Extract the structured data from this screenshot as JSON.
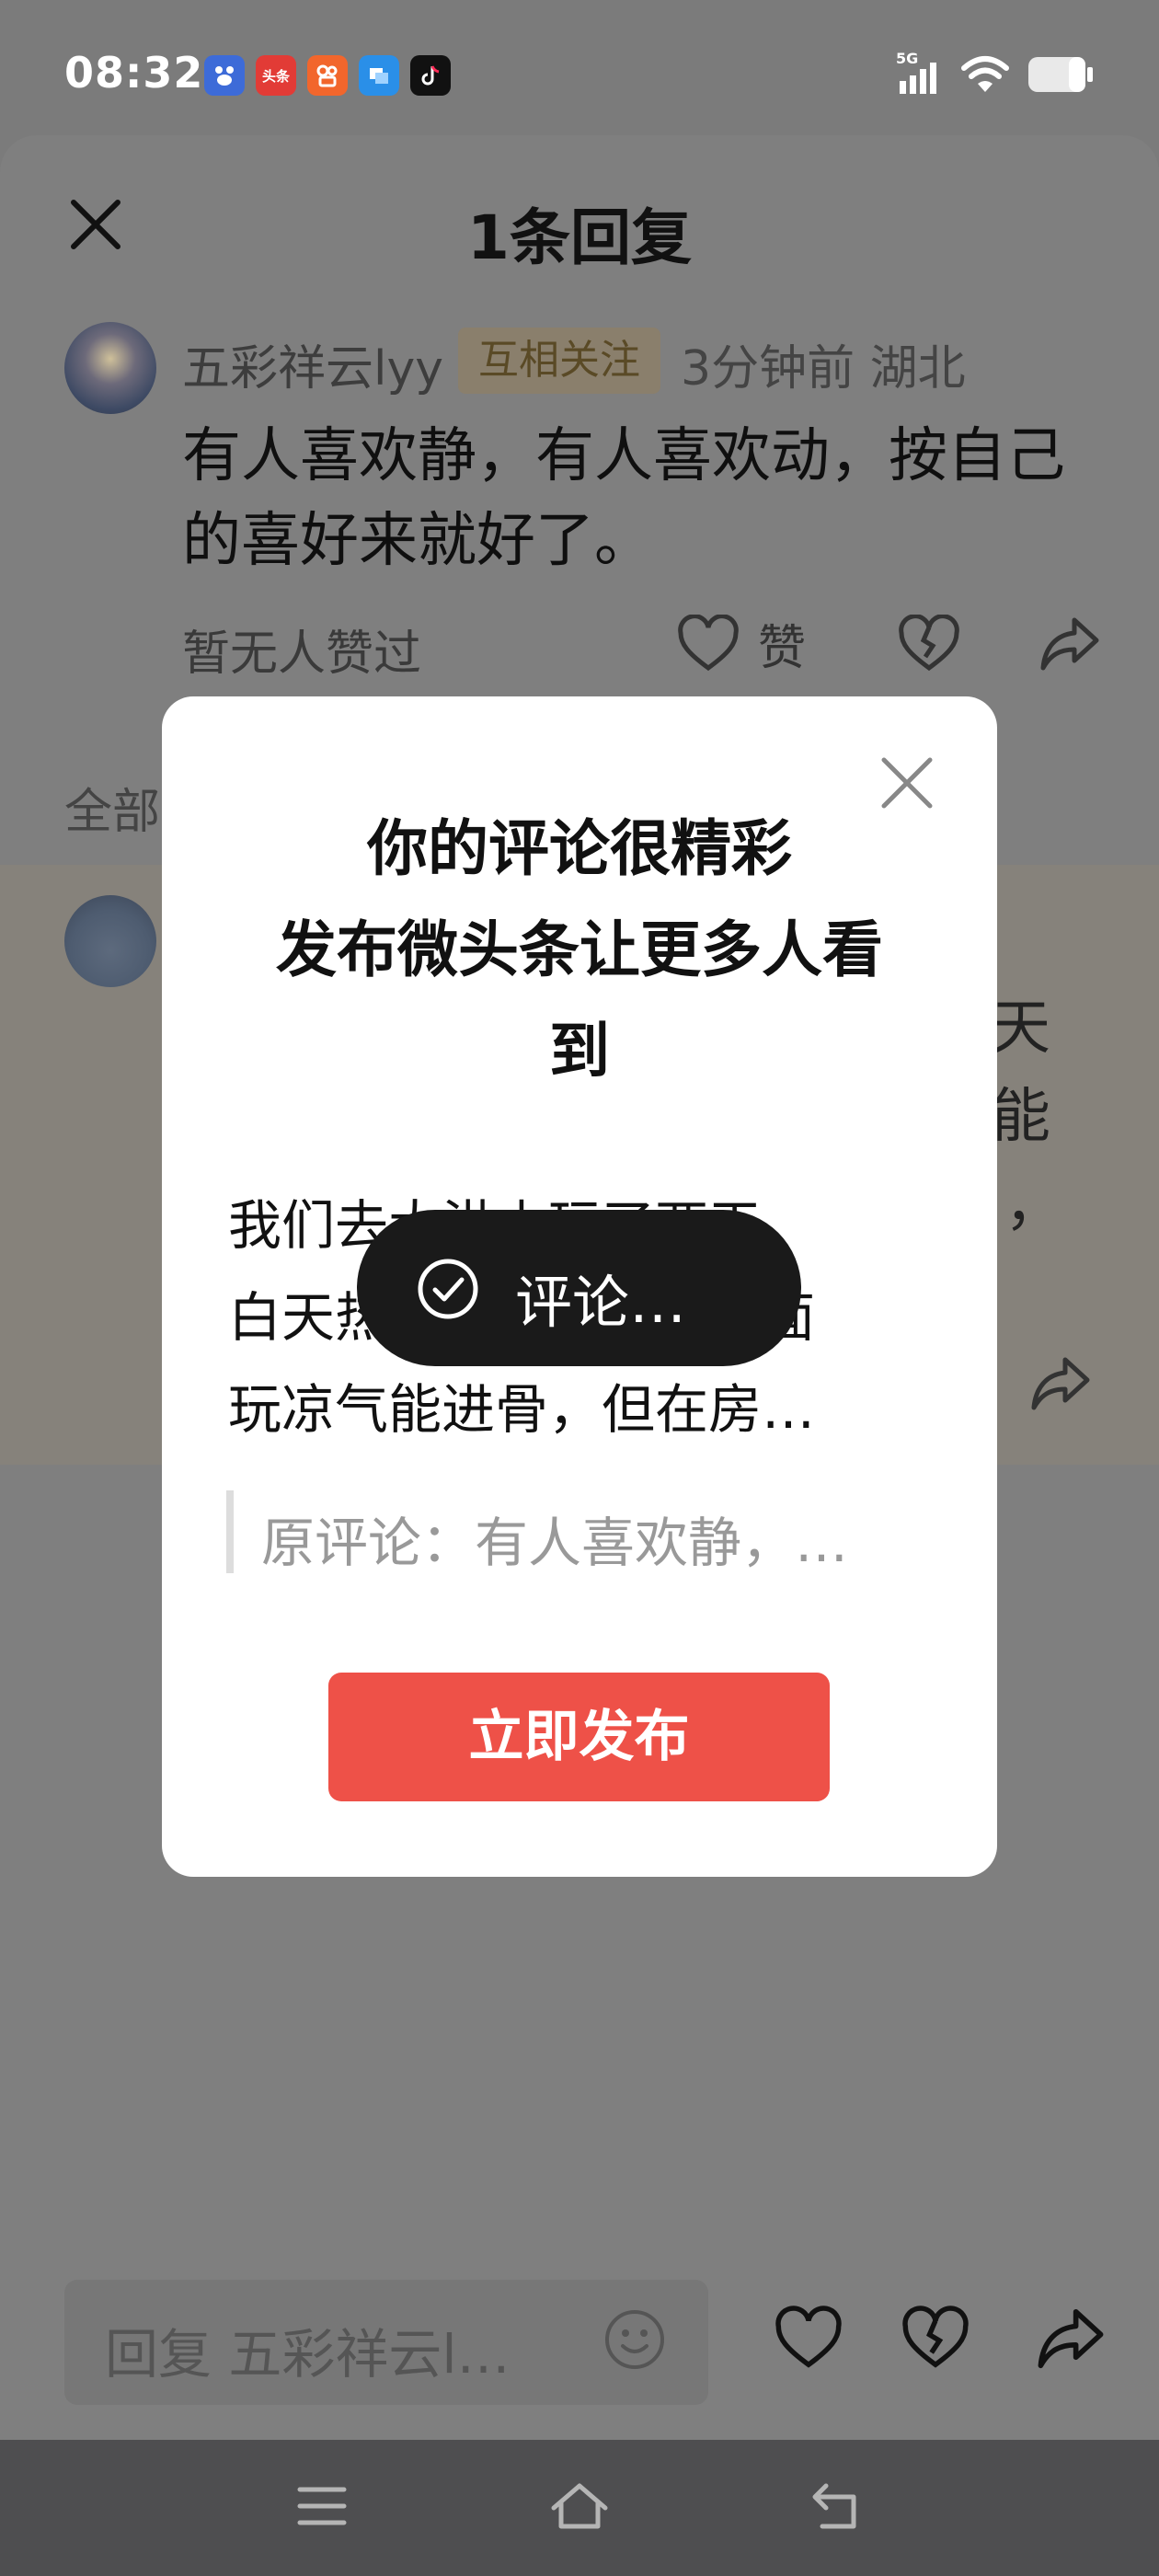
{
  "status_bar": {
    "time": "08:32",
    "network": "5G",
    "app_icons": [
      "baidu-icon",
      "toutiao-icon",
      "kuaishou-icon",
      "message-icon",
      "tiktok-icon"
    ],
    "toutiao_badge": "头条"
  },
  "sheet": {
    "title": "1条回复",
    "comment": {
      "user": "五彩祥云lyy",
      "tag": "互相关注",
      "meta": "3分钟前  湖北",
      "text": "有人喜欢静，有人喜欢动，按自己的喜好来就好了。",
      "likes": "暂无人赞过",
      "like_label": "赞"
    },
    "section_all": "全部",
    "band_fragments": [
      "天",
      "能",
      "，"
    ]
  },
  "modal": {
    "title_line1": "你的评论很精彩",
    "title_line2": "发布微头条让更多人看",
    "title_line3": "到",
    "body": "我们去大洪山玩了两天，\n白天热的很，夜晚在外面\n玩凉气能进骨，但在房…",
    "quote": "原评论：有人喜欢静，…",
    "publish_label": "立即发布"
  },
  "toast": {
    "text": "评论…"
  },
  "reply_bar": {
    "placeholder": "回复 五彩祥云l…"
  },
  "colors": {
    "accent": "#ee5148",
    "overlay": "#7f7f7f",
    "modal_bg": "#ffffff",
    "toast_bg": "#1a1a1a"
  }
}
